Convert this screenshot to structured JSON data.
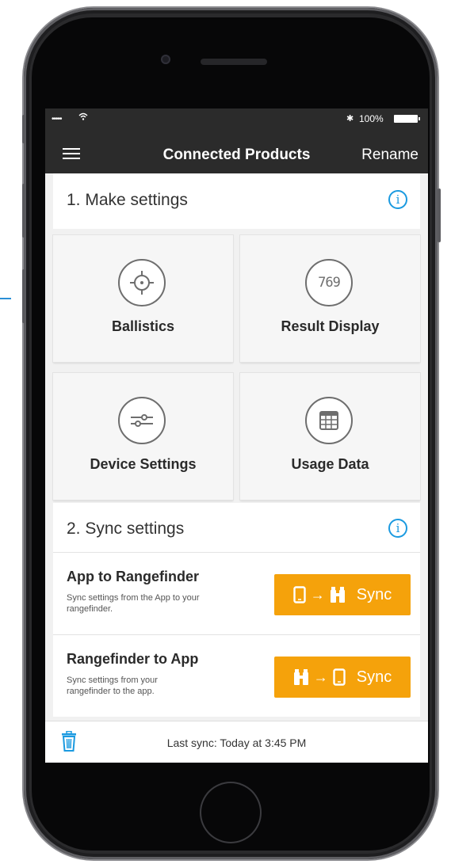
{
  "status_bar": {
    "signal": "•••••",
    "battery": "100%"
  },
  "nav": {
    "title": "Connected Products",
    "rename": "Rename"
  },
  "section1": {
    "title": "1. Make settings"
  },
  "tiles": [
    {
      "label": "Ballistics",
      "icon": "crosshair-icon"
    },
    {
      "label": "Result Display",
      "icon": "digital-display-icon",
      "display_value": "769"
    },
    {
      "label": "Device Settings",
      "icon": "sliders-icon"
    },
    {
      "label": "Usage Data",
      "icon": "grid-table-icon"
    }
  ],
  "section2": {
    "title": "2. Sync settings"
  },
  "sync_rows": [
    {
      "title": "App to Rangefinder",
      "description": "Sync settings from the App to your rangefinder.",
      "button": "Sync"
    },
    {
      "title": "Rangefinder to App",
      "description": "Sync settings from your rangefinder to the app.",
      "button": "Sync"
    }
  ],
  "footer": {
    "last_sync": "Last sync: Today at 3:45 PM"
  },
  "colors": {
    "accent": "#f5a20b",
    "info": "#1b9ae0",
    "nav_bg": "#2b2b2b"
  }
}
